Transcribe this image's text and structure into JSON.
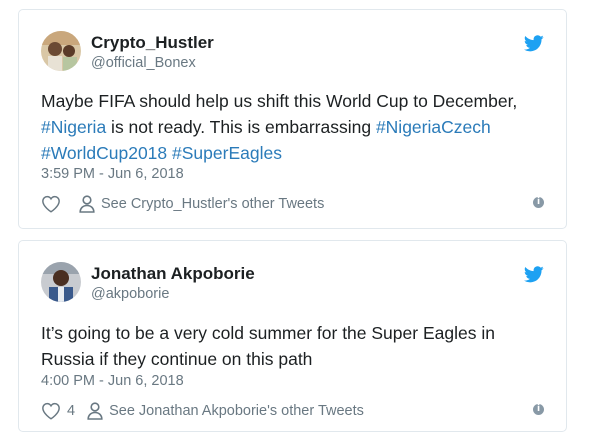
{
  "tweets": [
    {
      "name": "Crypto_Hustler",
      "handle": "@official_Bonex",
      "text_parts": [
        "Maybe FIFA should help us shift this World Cup to December, ",
        "#Nigeria",
        " is not ready. This is embarrassing ",
        "#NigeriaCzech",
        " ",
        "#WorldCup2018",
        " ",
        "#SuperEagles"
      ],
      "time": "3:59 PM - Jun 6, 2018",
      "like_count": "",
      "other_tweets_label": "See Crypto_Hustler's other Tweets"
    },
    {
      "name": "Jonathan Akpoborie",
      "handle": "@akpoborie",
      "text": "It’s going to be a very cold summer for the Super Eagles in Russia if they continue on this path",
      "time": "4:00 PM - Jun 6, 2018",
      "like_count": "4",
      "other_tweets_label": "See Jonathan Akpoborie's other Tweets"
    }
  ],
  "icons": {
    "twitter_bird": "twitter-bird-icon",
    "like": "heart-icon",
    "profile": "person-icon",
    "info": "info-icon"
  },
  "colors": {
    "hashtag": "#2b7bb9",
    "twitter_blue": "#1da1f2",
    "meta_text": "#697882",
    "border": "#e1e8ed"
  }
}
